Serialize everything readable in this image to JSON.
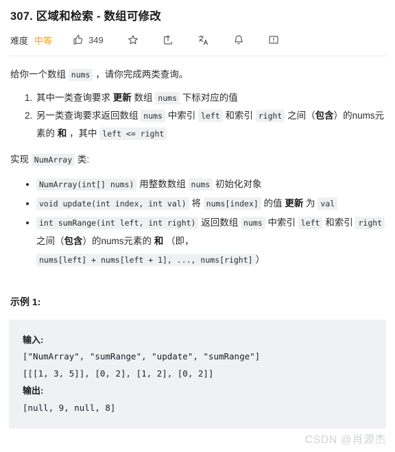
{
  "header": {
    "title": "307. 区域和检索 - 数组可修改",
    "difficulty_label": "难度",
    "difficulty_value": "中等",
    "difficulty_color": "#ffa116",
    "like_count": "349",
    "icons": [
      {
        "name": "thumbs-up-icon",
        "label": "点赞"
      },
      {
        "name": "star-icon",
        "label": "收藏"
      },
      {
        "name": "share-icon",
        "label": "分享"
      },
      {
        "name": "translate-icon",
        "label": "翻译"
      },
      {
        "name": "bell-icon",
        "label": "提醒"
      },
      {
        "name": "feedback-icon",
        "label": "反馈"
      }
    ]
  },
  "content": {
    "intro": {
      "before": "给你一个数组",
      "code": "nums",
      "after": "，请你完成两类查询。"
    },
    "numbered_items": [
      {
        "t1": "其中一类查询要求",
        "b1": "更新",
        "t2": "数组",
        "c1": "nums",
        "t3": "下标对应的值"
      },
      {
        "t1": "另一类查询要求返回数组",
        "c1": "nums",
        "t2": "中索引",
        "c2": "left",
        "t3": "和索引",
        "c3": "right",
        "t4": "之间（",
        "b1": "包含",
        "t5": "）的nums元素的",
        "b2": "和",
        "t6": "，其中",
        "c4": "left <= right"
      }
    ],
    "implement": {
      "before": "实现",
      "code": "NumArray",
      "after": "类:"
    },
    "methods": [
      {
        "c1": "NumArray(int[] nums)",
        "t1": "用整数数组",
        "c2": "nums",
        "t2": "初始化对象"
      },
      {
        "c1": "void update(int index, int val)",
        "t1": "将",
        "c2": "nums[index]",
        "t2": "的值",
        "b1": "更新",
        "t3": "为",
        "c3": "val"
      },
      {
        "c1": "int sumRange(int left, int right)",
        "t1": "返回数组",
        "c2": "nums",
        "t2": "中索引",
        "c3": "left",
        "t3": "和索引",
        "c4": "right",
        "t4": "之间（",
        "b1": "包含",
        "t5": "）的nums元素的",
        "b2": "和",
        "t6": "（即，",
        "c5": "nums[left] + nums[left + 1], ..., nums[right]",
        "t7": "）"
      }
    ]
  },
  "example": {
    "heading": "示例 1:",
    "input_label": "输入:",
    "input_line1": "[\"NumArray\", \"sumRange\", \"update\", \"sumRange\"]",
    "input_line2": "[[[1, 3, 5]], [0, 2], [1, 2], [0, 2]]",
    "output_label": "输出:",
    "output_line1": "[null, 9, null, 8]"
  },
  "watermark": {
    "text": "CSDN @肖源杰"
  }
}
